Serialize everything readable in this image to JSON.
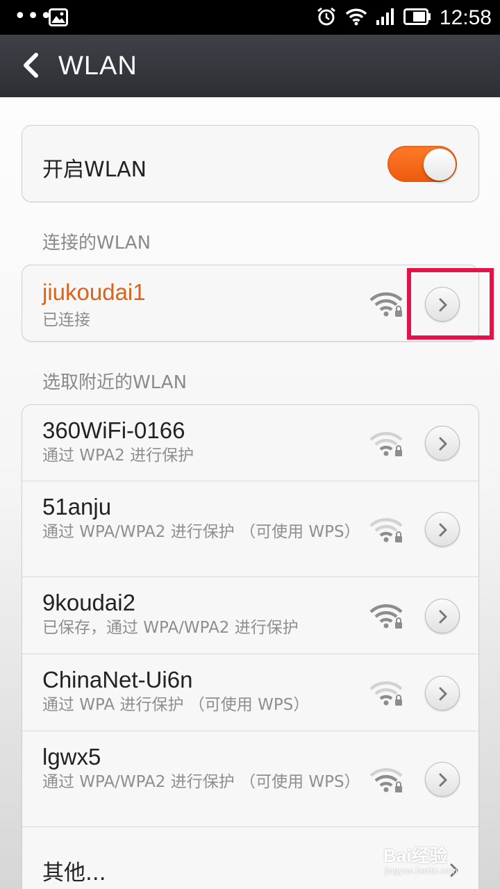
{
  "status_bar": {
    "dots": "•••",
    "time": "12:58",
    "icons": [
      "photo-icon",
      "alarm-icon",
      "wifi-icon",
      "signal-icon",
      "battery-icon"
    ]
  },
  "header": {
    "back_icon": "chevron-left-icon",
    "title": "WLAN"
  },
  "wlan_toggle": {
    "label": "开启WLAN",
    "enabled": true,
    "accent_color": "#f26a1b"
  },
  "connected_section": {
    "label": "连接的WLAN",
    "network": {
      "name": "jiukoudai1",
      "status": "已连接",
      "name_color": "#d9641c",
      "signal": "strong",
      "secured": true
    }
  },
  "nearby_section": {
    "label": "选取附近的WLAN",
    "networks": [
      {
        "name": "360WiFi-0166",
        "security": "通过 WPA2 进行保护",
        "signal": "weak"
      },
      {
        "name": "51anju",
        "security": "通过 WPA/WPA2 进行保护 （可使用 WPS）",
        "signal": "weak"
      },
      {
        "name": "9koudai2",
        "security": "已保存，通过 WPA/WPA2 进行保护",
        "signal": "strong"
      },
      {
        "name": "ChinaNet-Ui6n",
        "security": "通过 WPA 进行保护 （可使用 WPS）",
        "signal": "weak"
      },
      {
        "name": "lgwx5",
        "security": "通过 WPA/WPA2 进行保护 （可使用 WPS）",
        "signal": "medium"
      }
    ],
    "other_label": "其他..."
  },
  "annotation": {
    "highlight_color": "#e5124a"
  },
  "watermark": {
    "main": "Bai经验",
    "sub": "jingyan.baidu.com"
  }
}
